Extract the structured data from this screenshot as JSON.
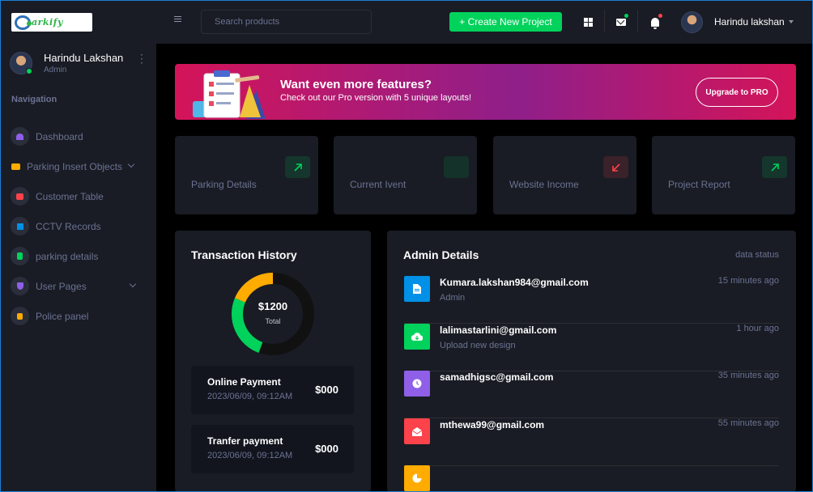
{
  "brand": {
    "logo_text": "arkify"
  },
  "sidebar": {
    "profile": {
      "name": "Harindu Lakshan",
      "role": "Admin"
    },
    "nav_title": "Navigation",
    "items": [
      {
        "label": "Dashboard",
        "icon": "speedometer-icon",
        "color": "#8f5fe8"
      },
      {
        "label": "Parking Insert Objects",
        "icon": "laptop-icon",
        "color": "#ffab00"
      },
      {
        "label": "Customer Table",
        "icon": "table-icon",
        "color": "#fc424a"
      },
      {
        "label": "CCTV Records",
        "icon": "bar-chart-icon",
        "color": "#0090e7"
      },
      {
        "label": "parking details",
        "icon": "contacts-icon",
        "color": "#00d25b"
      },
      {
        "label": "User Pages",
        "icon": "security-icon",
        "color": "#8f5fe8"
      },
      {
        "label": "Police panel",
        "icon": "file-document-icon",
        "color": "#ffab00"
      }
    ]
  },
  "topbar": {
    "search_placeholder": "Search products",
    "create_label": "+ Create New Project",
    "user_name": "Harindu lakshan"
  },
  "banner": {
    "title": "Want even more features?",
    "subtitle": "Check out our Pro version with 5 unique layouts!",
    "upgrade_label": "Upgrade to PRO"
  },
  "stats": [
    {
      "label": "Parking Details",
      "icon": "arrow-top-right-icon",
      "color": "#00d25b"
    },
    {
      "label": "Current Ivent",
      "icon": "blank-icon",
      "color": "#00d25b"
    },
    {
      "label": "Website Income",
      "icon": "arrow-bottom-left-icon",
      "color": "#fc424a"
    },
    {
      "label": "Project Report",
      "icon": "arrow-top-right-icon",
      "color": "#00d25b"
    }
  ],
  "transactions": {
    "title": "Transaction History",
    "total_value": "$1200",
    "total_label": "Total",
    "donut_colors": [
      "#111111",
      "#00d25b",
      "#ffab00"
    ],
    "payments": [
      {
        "title": "Online Payment",
        "date": "2023/06/09, 09:12AM",
        "amount": "$000"
      },
      {
        "title": "Tranfer payment",
        "date": "2023/06/09, 09:12AM",
        "amount": "$000"
      }
    ]
  },
  "admin": {
    "title": "Admin Details",
    "status_label": "data status",
    "rows": [
      {
        "email": "Kumara.lakshan984@gmail.com",
        "desc": "Admin",
        "time": "15 minutes ago",
        "icon": "file-icon",
        "color": "#0090e7"
      },
      {
        "email": "lalimastarlini@gmail.com",
        "desc": "Upload new design",
        "time": "1 hour ago",
        "icon": "cloud-download-icon",
        "color": "#00d25b"
      },
      {
        "email": "samadhigsc@gmail.com",
        "desc": "",
        "time": "35 minutes ago",
        "icon": "clock-icon",
        "color": "#8f5fe8"
      },
      {
        "email": "mthewa99@gmail.com",
        "desc": "",
        "time": "55 minutes ago",
        "icon": "email-open-icon",
        "color": "#fc424a"
      },
      {
        "email": "",
        "desc": "",
        "time": "",
        "icon": "chart-pie-icon",
        "color": "#ffab00"
      }
    ]
  }
}
